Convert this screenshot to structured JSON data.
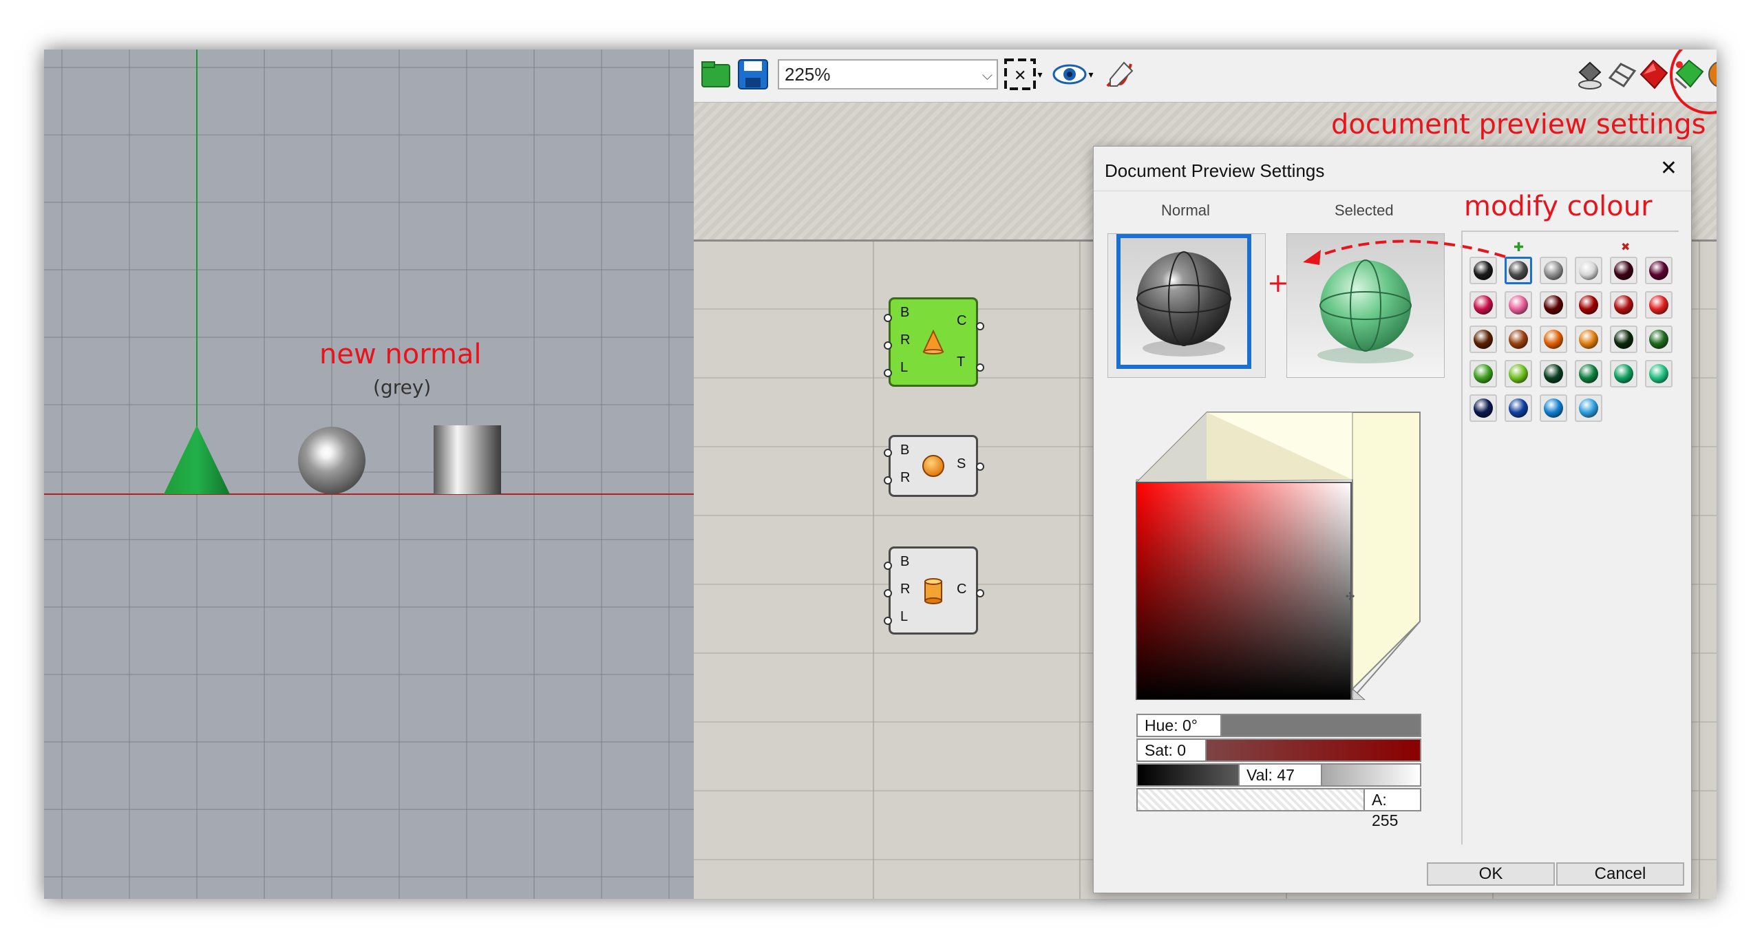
{
  "viewport": {
    "annotation_title": "new normal",
    "annotation_sub": "(grey)"
  },
  "toolbar": {
    "zoom_value": "225%",
    "annotation": "document preview settings"
  },
  "components": [
    {
      "name": "cone",
      "inputs": [
        "B",
        "R",
        "L"
      ],
      "outputs": [
        "C",
        "T"
      ]
    },
    {
      "name": "sphere",
      "inputs": [
        "B",
        "R"
      ],
      "outputs": [
        "S"
      ]
    },
    {
      "name": "cylinder",
      "inputs": [
        "B",
        "R",
        "L"
      ],
      "outputs": [
        "C"
      ]
    }
  ],
  "dialog": {
    "title": "Document Preview Settings",
    "close_glyph": "✕",
    "normal_label": "Normal",
    "selected_label": "Selected",
    "annotation": "modify colour",
    "hue_label": "Hue: 0°",
    "sat_label": "Sat: 0",
    "val_label": "Val: 47",
    "alpha_label": "A: 255",
    "ok_label": "OK",
    "cancel_label": "Cancel",
    "add_glyph": "✚",
    "remove_glyph": "✖",
    "swatches": [
      "#1a1a1a",
      "#4a4a4a",
      "#8f8f8f",
      "#d8d8d8",
      "#3a0014",
      "#5a0030",
      "#c8104a",
      "#e8609a",
      "#5a0000",
      "#a00000",
      "#b01010",
      "#e02020",
      "#5a2000",
      "#9a4010",
      "#e06000",
      "#e08010",
      "#0a2a0a",
      "#1e6a1e",
      "#40a020",
      "#70c020",
      "#0a4020",
      "#108040",
      "#10a060",
      "#20c080",
      "#0a1a50",
      "#1040a0",
      "#1080d0",
      "#30a0e0"
    ],
    "colors": {
      "accent": "#e8141c",
      "selected_border": "#1a6fd1"
    }
  }
}
